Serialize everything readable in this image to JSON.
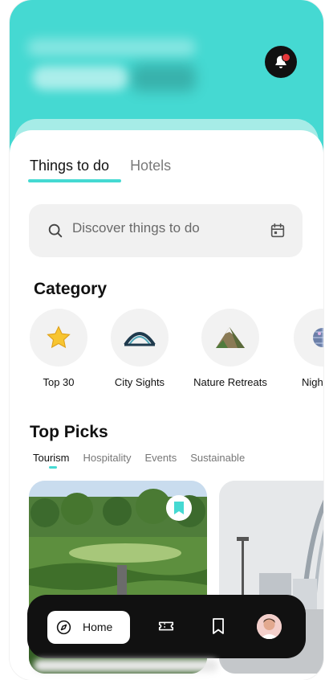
{
  "header": {
    "bell_icon": "bell-notification-icon",
    "accent_color": "#45d9d2"
  },
  "tabs": [
    {
      "label": "Things to do",
      "active": true
    },
    {
      "label": "Hotels",
      "active": false
    }
  ],
  "search": {
    "placeholder": "Discover things to do",
    "icon": "search-icon",
    "calendar_icon": "calendar-icon"
  },
  "category": {
    "title": "Category",
    "items": [
      {
        "label": "Top 30",
        "icon": "star-icon"
      },
      {
        "label": "City Sights",
        "icon": "bridge-icon"
      },
      {
        "label": "Nature Retreats",
        "icon": "mountain-icon"
      },
      {
        "label": "Night",
        "icon": "disco-ball-icon"
      }
    ]
  },
  "top_picks": {
    "title": "Top Picks",
    "filters": [
      {
        "label": "Tourism",
        "active": true
      },
      {
        "label": "Hospitality",
        "active": false
      },
      {
        "label": "Events",
        "active": false
      },
      {
        "label": "Sustainable",
        "active": false
      }
    ]
  },
  "bottom_nav": {
    "home_label": "Home",
    "items": [
      "compass-icon",
      "ticket-icon",
      "bookmark-icon",
      "avatar"
    ]
  }
}
